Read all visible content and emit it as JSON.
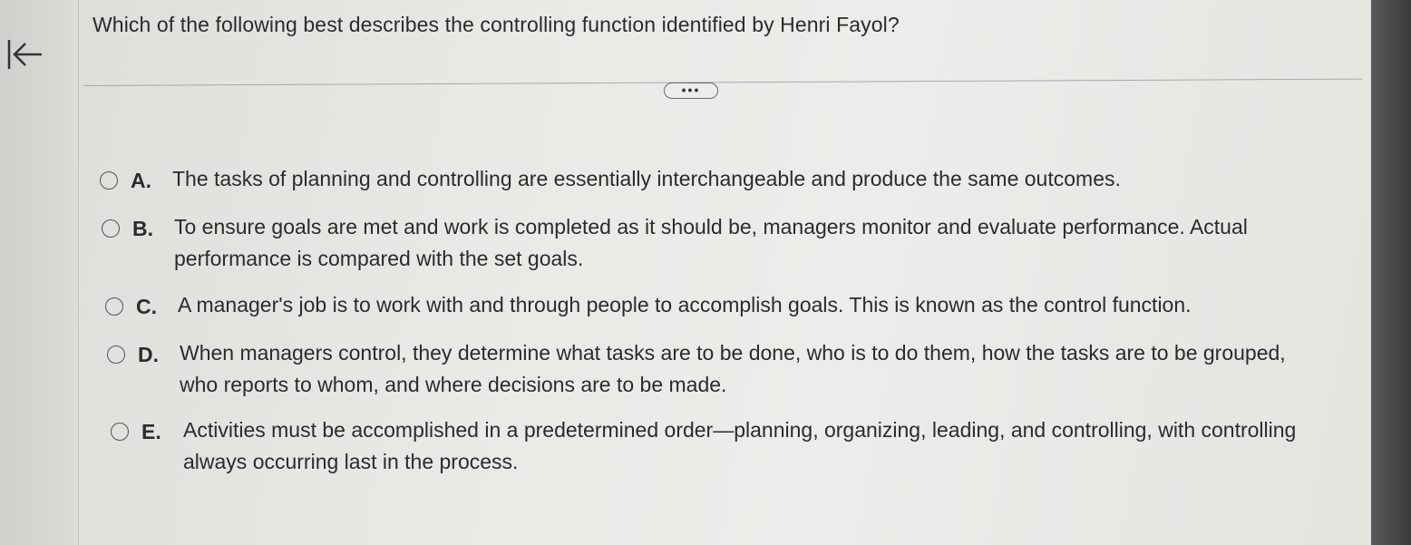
{
  "question": "Which of the following best describes the controlling function identified by Henri Fayol?",
  "more_label": "•••",
  "options": [
    {
      "letter": "A.",
      "text": "The tasks of planning and controlling are essentially interchangeable and produce the same outcomes."
    },
    {
      "letter": "B.",
      "text": "To ensure goals are met and work is completed as it should be, managers monitor and evaluate performance. Actual performance is compared with the set goals."
    },
    {
      "letter": "C.",
      "text": "A manager's job is to work with and through people to accomplish goals. This is known as the control function."
    },
    {
      "letter": "D.",
      "text": "When managers control, they determine what tasks are to be done, who is to do them, how the tasks are to be grouped, who reports to whom, and where decisions are to be made."
    },
    {
      "letter": "E.",
      "text": "Activities must be accomplished in a predetermined order—planning, organizing, leading, and controlling, with controlling always occurring last in the process."
    }
  ],
  "icons": {
    "collapse": "collapse-left-icon"
  }
}
